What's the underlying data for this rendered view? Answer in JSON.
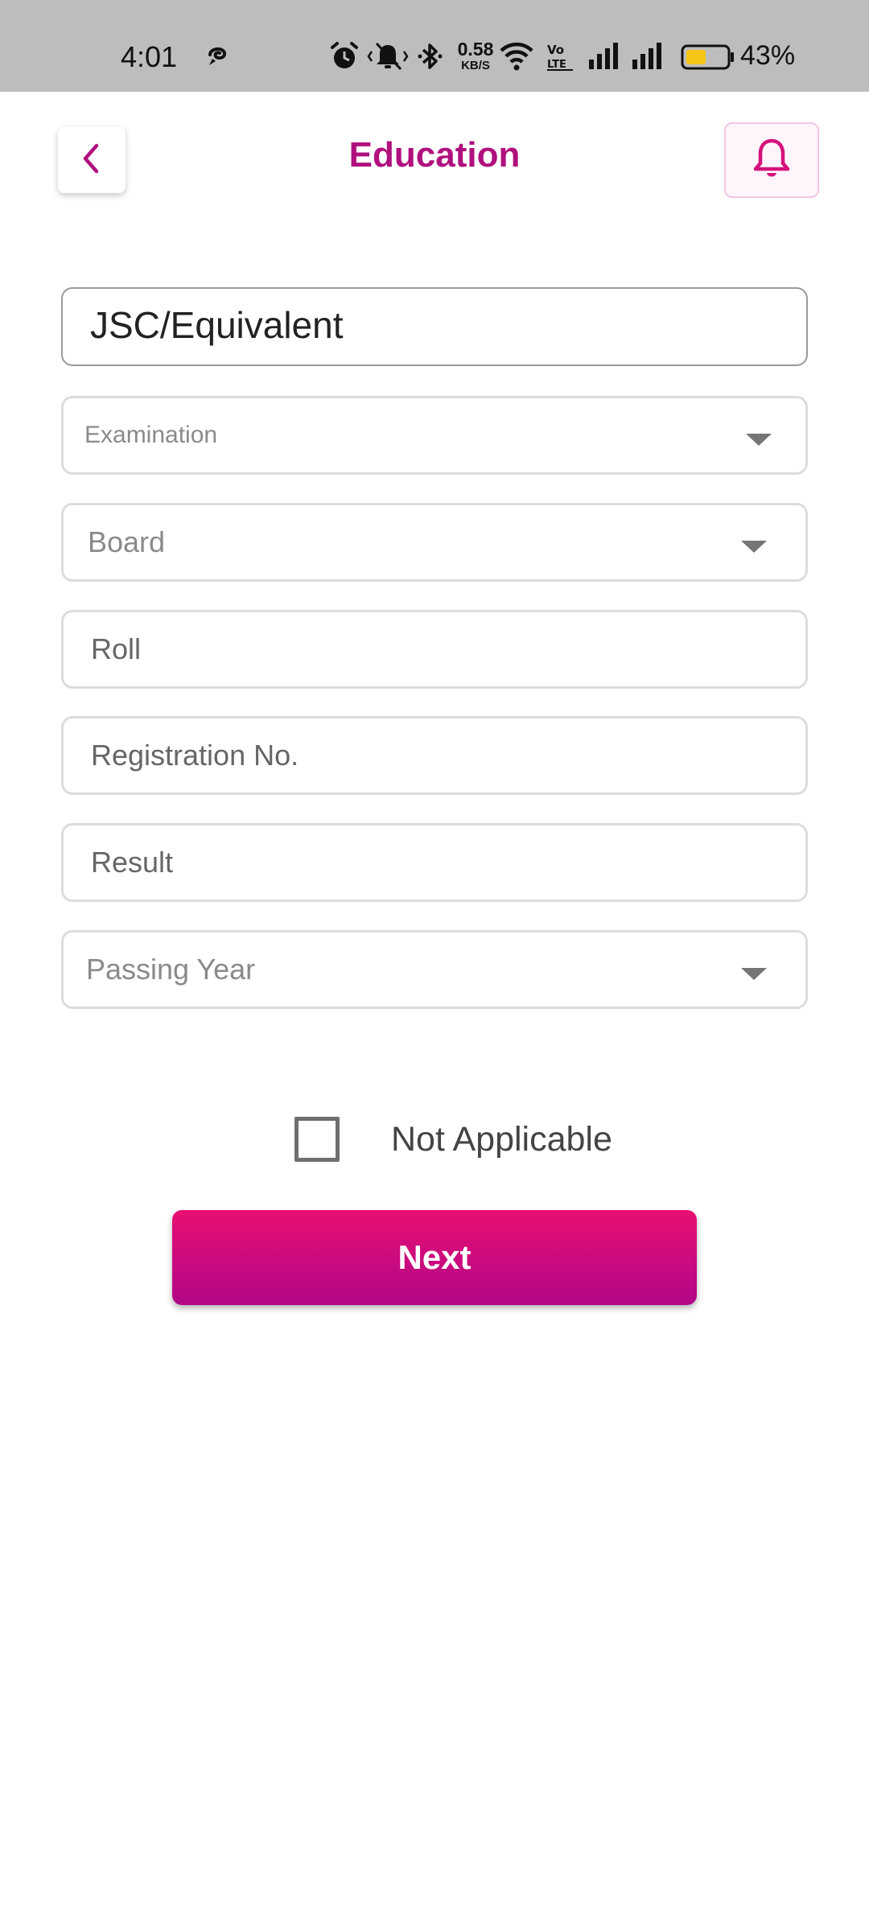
{
  "status_bar": {
    "time": "4:01",
    "net_speed_value": "0.58",
    "net_speed_unit": "KB/S",
    "battery_percent": "43%",
    "icons": [
      "alarm-icon",
      "vibrate-off-icon",
      "bluetooth-icon",
      "wifi-icon",
      "volte-icon",
      "signal-icon",
      "signal-icon",
      "battery-icon"
    ]
  },
  "header": {
    "title": "Education",
    "back_icon": "chevron-left-icon",
    "notification_icon": "bell-icon"
  },
  "form": {
    "section_title": "JSC/Equivalent",
    "examination": {
      "placeholder": "Examination"
    },
    "board": {
      "placeholder": "Board"
    },
    "roll": {
      "placeholder": "Roll"
    },
    "registration": {
      "placeholder": "Registration No."
    },
    "result": {
      "placeholder": "Result"
    },
    "passing_year": {
      "placeholder": "Passing Year"
    },
    "not_applicable_label": "Not Applicable",
    "next_label": "Next"
  },
  "colors": {
    "accent": "#b0107e",
    "button_gradient_top": "#e80f72",
    "button_gradient_bottom": "#b10788",
    "status_bar_bg": "#bdbdbd",
    "battery_fill": "#f5c518"
  }
}
